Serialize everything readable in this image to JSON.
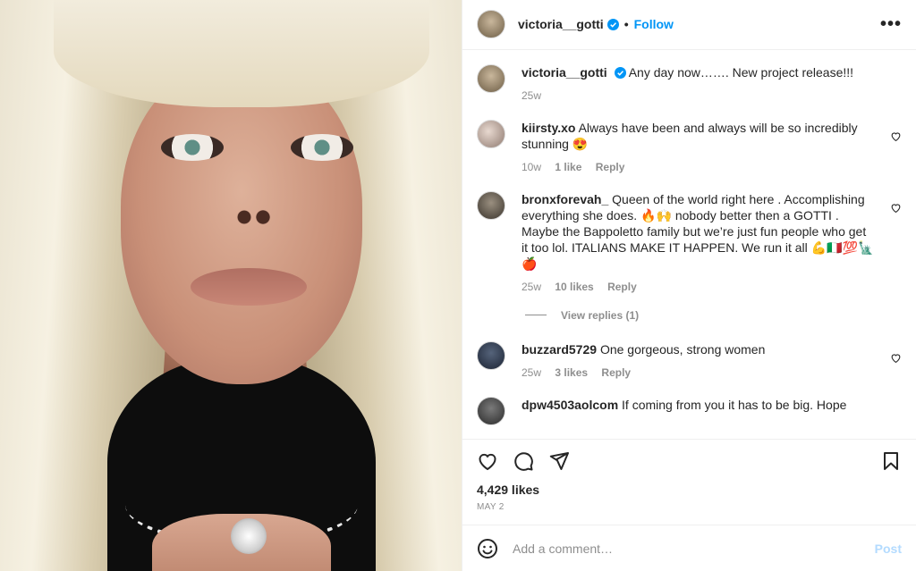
{
  "header": {
    "username": "victoria__gotti",
    "dot": "•",
    "follow_label": "Follow",
    "more_label": "•••"
  },
  "caption": {
    "username": "victoria__gotti",
    "text": "Any day now……. New project release!!!",
    "age": "25w"
  },
  "comments": [
    {
      "user": "kiirsty.xo",
      "text": "Always have been and always will be so incredibly stunning 😍",
      "age": "10w",
      "likes": "1 like",
      "reply": "Reply"
    },
    {
      "user": "bronxforevah_",
      "text": "Queen of the world right here . Accomplishing everything she does. 🔥🙌 nobody better then a GOTTI . Maybe the Bappoletto family but we’re just fun people who get it too lol. ITALIANS MAKE IT HAPPEN. We run it all 💪🇮🇹💯🗽🍎",
      "age": "25w",
      "likes": "10 likes",
      "reply": "Reply"
    },
    {
      "user": "buzzard5729",
      "text": "One gorgeous, strong women",
      "age": "25w",
      "likes": "3 likes",
      "reply": "Reply"
    },
    {
      "user": "dpw4503aolcom",
      "text": "If coming from you it has to be big. Hope",
      "age": "",
      "likes": "",
      "reply": ""
    }
  ],
  "view_replies": "View replies (1)",
  "likes_count": "4,429 likes",
  "date": "MAY 2",
  "add_comment": {
    "placeholder": "Add a comment…",
    "post_label": "Post"
  },
  "colors": {
    "link": "#0095f6",
    "muted": "#8e8e8e",
    "post_disabled": "#b3dbff"
  }
}
